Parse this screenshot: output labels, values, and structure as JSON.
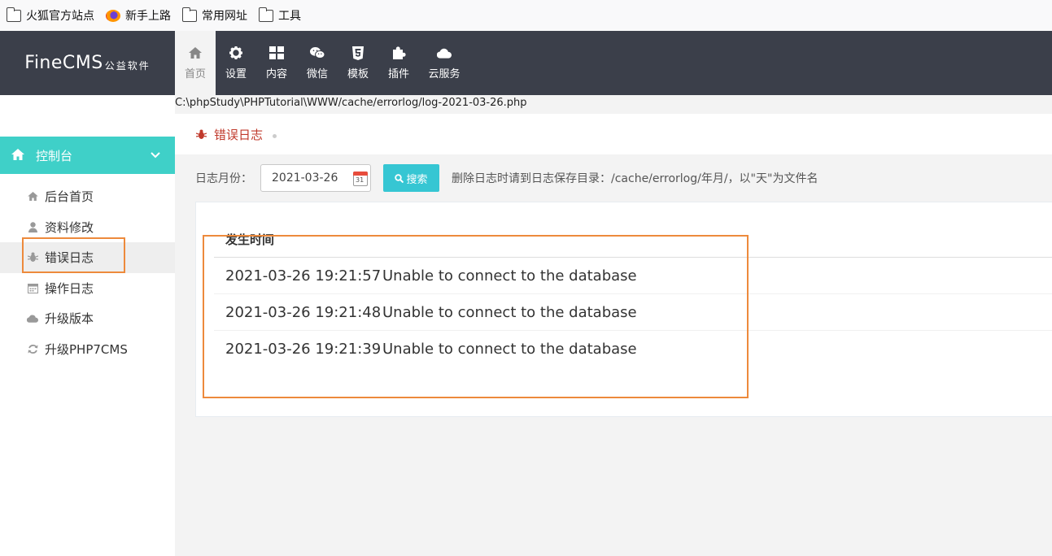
{
  "bookmarks": [
    {
      "label": "火狐官方站点",
      "icon": "folder-icon"
    },
    {
      "label": "新手上路",
      "icon": "firefox-icon"
    },
    {
      "label": "常用网址",
      "icon": "folder-icon"
    },
    {
      "label": "工具",
      "icon": "folder-icon"
    }
  ],
  "header": {
    "logo_main": "FineCMS",
    "logo_sub": "公益软件",
    "nav": [
      {
        "label": "首页",
        "icon": "home-icon"
      },
      {
        "label": "设置",
        "icon": "gear-icon"
      },
      {
        "label": "内容",
        "icon": "grid-icon"
      },
      {
        "label": "微信",
        "icon": "wechat-icon"
      },
      {
        "label": "模板",
        "icon": "html5-icon"
      },
      {
        "label": "插件",
        "icon": "puzzle-icon"
      },
      {
        "label": "云服务",
        "icon": "cloud-icon"
      }
    ]
  },
  "path_text": "C:\\phpStudy\\PHPTutorial\\WWW/cache/errorlog/log-2021-03-26.php",
  "sidebar": {
    "section": "控制台",
    "items": [
      {
        "label": "后台首页",
        "icon": "home-icon"
      },
      {
        "label": "资料修改",
        "icon": "user-icon"
      },
      {
        "label": "错误日志",
        "icon": "bug-icon"
      },
      {
        "label": "操作日志",
        "icon": "calendar-icon"
      },
      {
        "label": "升级版本",
        "icon": "cloud-icon"
      },
      {
        "label": "升级PHP7CMS",
        "icon": "refresh-icon"
      }
    ]
  },
  "breadcrumb": {
    "title": "错误日志"
  },
  "filter": {
    "label": "日志月份：",
    "date_value": "2021-03-26",
    "calendar_day": "31",
    "search_label": "搜索",
    "hint": "删除日志时请到日志保存目录：/cache/errorlog/年月/，以\"天\"为文件名"
  },
  "table": {
    "header": "发生时间",
    "rows": [
      {
        "time": "2021-03-26 19:21:57",
        "message": "Unable to connect to the database"
      },
      {
        "time": "2021-03-26 19:21:48",
        "message": "Unable to connect to the database"
      },
      {
        "time": "2021-03-26 19:21:39",
        "message": "Unable to connect to the database"
      }
    ]
  },
  "colors": {
    "accent": "#3fd0c8",
    "highlight": "#ed8a3c",
    "header_bg": "#3b3f4a",
    "search_btn": "#36c6d3",
    "error_red": "#c0392b"
  }
}
